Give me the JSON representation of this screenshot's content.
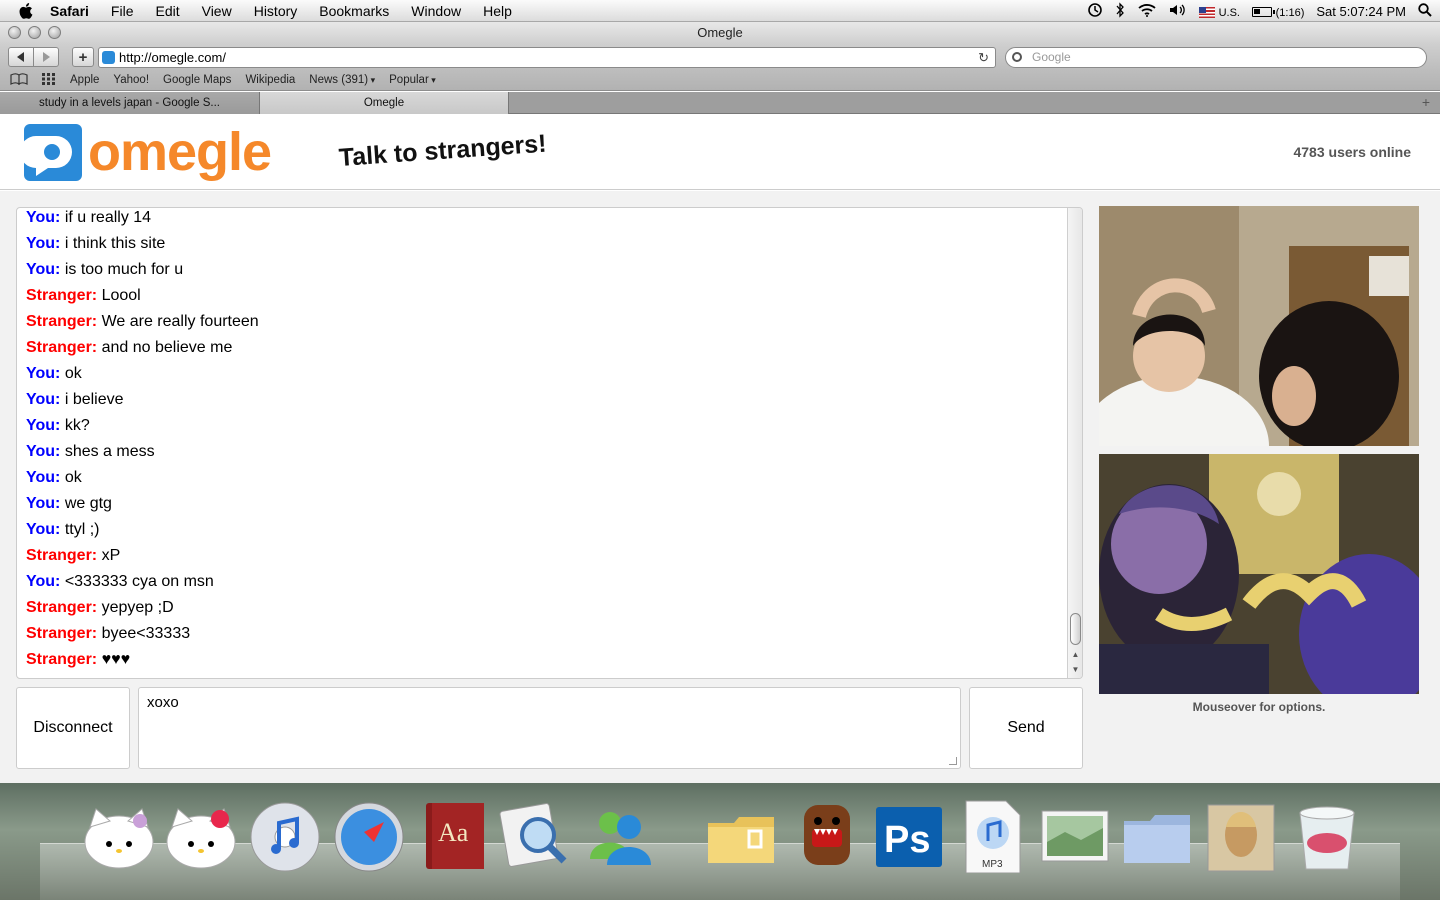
{
  "menubar": {
    "app_name": "Safari",
    "menus": [
      "File",
      "Edit",
      "View",
      "History",
      "Bookmarks",
      "Window",
      "Help"
    ],
    "input_source": "U.S.",
    "battery": "(1:16)",
    "clock": "Sat 5:07:24 PM"
  },
  "window": {
    "title": "Omegle",
    "url": "http://omegle.com/",
    "search_placeholder": "Google"
  },
  "bookmarks_bar": [
    "Apple",
    "Yahoo!",
    "Google Maps",
    "Wikipedia",
    "News (391)",
    "Popular"
  ],
  "tabs": [
    "study in a levels japan - Google S...",
    "Omegle"
  ],
  "omegle": {
    "logo_text": "omegle",
    "tagline": "Talk to strangers!",
    "users_online": "4783 users online",
    "chat": [
      {
        "who": "You:",
        "text": "if u really 14"
      },
      {
        "who": "You:",
        "text": "i think this site"
      },
      {
        "who": "You:",
        "text": "is too much for u"
      },
      {
        "who": "Stranger:",
        "text": "Loool"
      },
      {
        "who": "Stranger:",
        "text": "We are really fourteen"
      },
      {
        "who": "Stranger:",
        "text": "and no believe me"
      },
      {
        "who": "You:",
        "text": "ok"
      },
      {
        "who": "You:",
        "text": "i believe"
      },
      {
        "who": "You:",
        "text": "kk?"
      },
      {
        "who": "You:",
        "text": "shes a mess"
      },
      {
        "who": "You:",
        "text": "ok"
      },
      {
        "who": "You:",
        "text": "we gtg"
      },
      {
        "who": "You:",
        "text": "ttyl ;)"
      },
      {
        "who": "Stranger:",
        "text": "xP"
      },
      {
        "who": "You:",
        "text": "<333333 cya on msn"
      },
      {
        "who": "Stranger:",
        "text": "yepyep ;D"
      },
      {
        "who": "Stranger:",
        "text": "byee<33333"
      },
      {
        "who": "Stranger:",
        "text": "♥♥♥"
      }
    ],
    "disconnect_label": "Disconnect",
    "message_value": "xoxo",
    "send_label": "Send",
    "video_hint": "Mouseover for options."
  },
  "dock": {
    "apps": [
      "hello-kitty-1",
      "hello-kitty-2",
      "itunes",
      "safari",
      "dictionary",
      "preview",
      "messenger",
      "folder",
      "domo",
      "photoshop",
      "mp3",
      "photos",
      "folder-blue",
      "album",
      "trash"
    ],
    "mp3_label": "MP3",
    "ps_label": "Ps",
    "dict_label": "Aa"
  },
  "colors": {
    "you": "#0000ff",
    "stranger": "#ff0000",
    "omegle_orange": "#f5882a",
    "omegle_blue": "#2a8ad8"
  }
}
